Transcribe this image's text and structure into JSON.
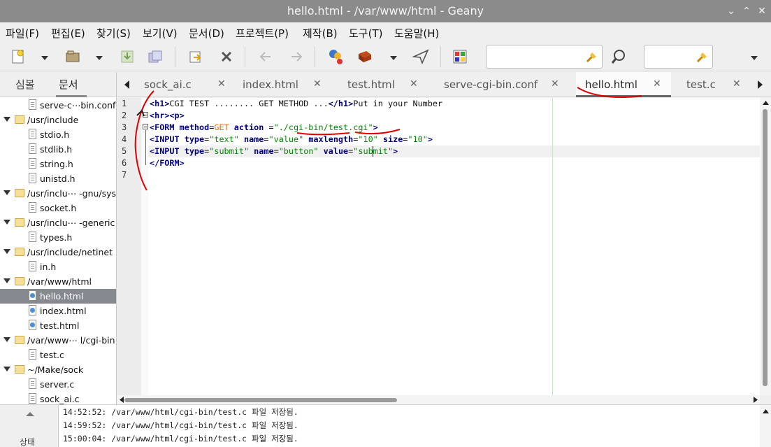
{
  "window": {
    "title": "hello.html - /var/www/html - Geany",
    "controls": [
      "⌄",
      "⌃",
      "✕"
    ]
  },
  "menu": [
    "파일(F)",
    "편집(E)",
    "찾기(S)",
    "보기(V)",
    "문서(D)",
    "프로젝트(P)",
    "제작(B)",
    "도구(T)",
    "도움말(H)"
  ],
  "toolbar": {
    "search_value": "",
    "goto_value": ""
  },
  "sidebar": {
    "tabs": [
      "심볼",
      "문서"
    ],
    "active_tab": "문서",
    "tree": [
      {
        "type": "file",
        "label": "serve-c⋯bin.conf"
      },
      {
        "type": "folder",
        "label": "/usr/include"
      },
      {
        "type": "file",
        "label": "stdio.h"
      },
      {
        "type": "file",
        "label": "stdlib.h"
      },
      {
        "type": "file",
        "label": "string.h"
      },
      {
        "type": "file",
        "label": "unistd.h"
      },
      {
        "type": "folder",
        "label": "/usr/inclu⋯ -gnu/sys"
      },
      {
        "type": "file",
        "label": "socket.h"
      },
      {
        "type": "folder",
        "label": "/usr/inclu⋯  -generic"
      },
      {
        "type": "file",
        "label": "types.h"
      },
      {
        "type": "folder",
        "label": "/usr/include/netinet"
      },
      {
        "type": "file",
        "label": "in.h"
      },
      {
        "type": "folder",
        "label": "/var/www/html"
      },
      {
        "type": "html",
        "label": "hello.html",
        "selected": true
      },
      {
        "type": "html",
        "label": "index.html"
      },
      {
        "type": "html",
        "label": "test.html"
      },
      {
        "type": "folder",
        "label": "/var/www⋯  l/cgi-bin"
      },
      {
        "type": "file",
        "label": "test.c"
      },
      {
        "type": "folder",
        "label": "~/Make/sock"
      },
      {
        "type": "file",
        "label": "server.c"
      },
      {
        "type": "file",
        "label": "sock_ai.c"
      }
    ]
  },
  "editor_tabs": [
    {
      "label": "sock_ai.c",
      "close": "✕"
    },
    {
      "label": "index.html",
      "close": "✕"
    },
    {
      "label": "test.html",
      "close": "✕"
    },
    {
      "label": "serve-cgi-bin.conf",
      "close": "✕"
    },
    {
      "label": "hello.html",
      "close": "✕",
      "active": true
    },
    {
      "label": "test.c",
      "close": "✕"
    }
  ],
  "editor": {
    "line_numbers": [
      "1",
      "2",
      "3",
      "4",
      "5",
      "6",
      "7"
    ],
    "lines": [
      "<h1>CGI TEST ........ GET METHOD ...</h1>Put in your Number",
      "<hr><p>",
      "<FORM method=GET action =\"./cgi-bin/test.cgi\">",
      "<INPUT type=\"text\" name=\"value\" maxlength=\"10\" size=\"10\">",
      "<INPUT type=\"submit\" name=\"button\" value=\"submit\">",
      "</FORM>",
      ""
    ]
  },
  "messages": [
    "14:52:52: /var/www/html/cgi-bin/test.c 파일 저장됨.",
    "14:59:52: /var/www/html/cgi-bin/test.c 파일 저장됨.",
    "15:00:04: /var/www/html/cgi-bin/test.c 파일 저장됨."
  ],
  "message_side_label": "상태",
  "colors": {
    "titlebar": "#8b8b8b",
    "selection": "#868a90",
    "annotation": "#e00000",
    "tag": "#000080",
    "string": "#008800"
  },
  "icons": [
    "new-file-icon",
    "open-file-icon",
    "save-icon",
    "save-all-icon",
    "revert-icon",
    "close-icon",
    "back-icon",
    "forward-icon",
    "compile-icon",
    "build-icon",
    "run-icon",
    "color-chooser-icon",
    "clear-icon",
    "search-icon"
  ]
}
